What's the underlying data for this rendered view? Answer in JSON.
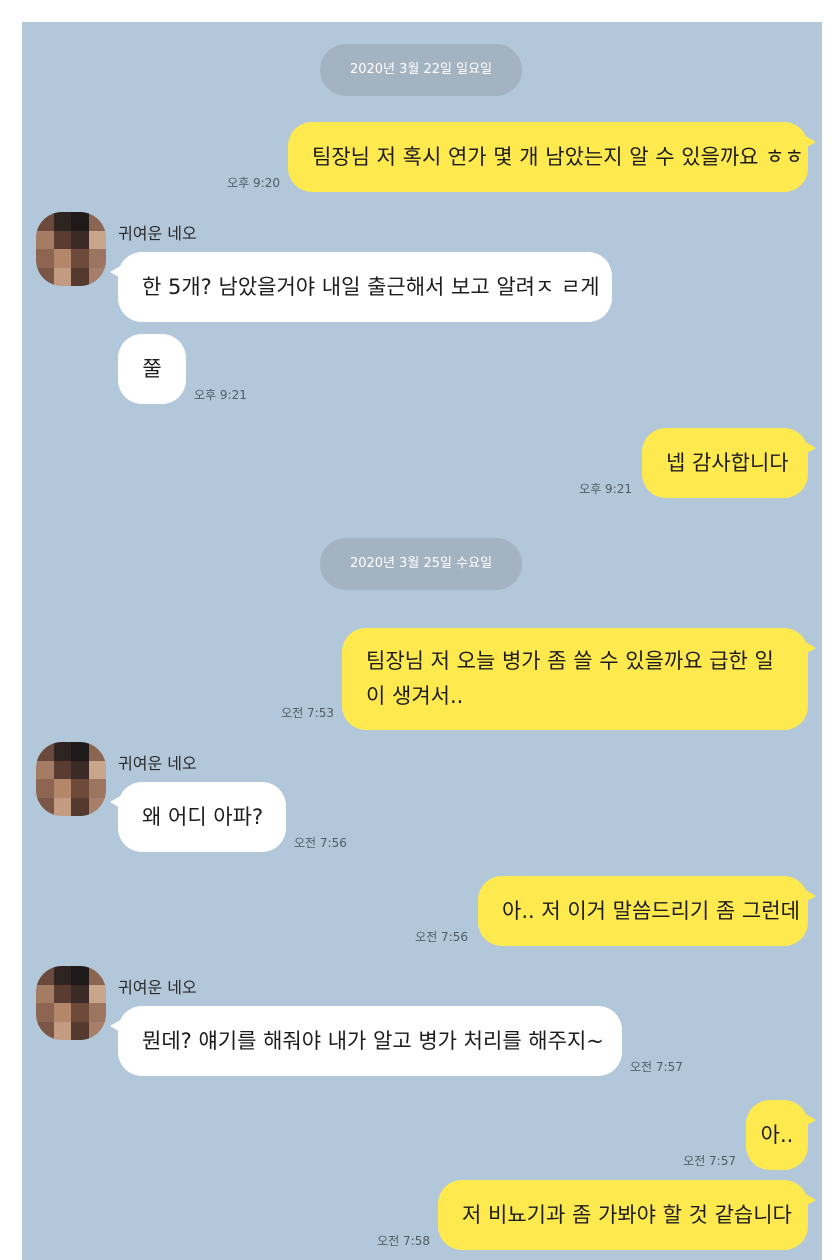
{
  "contact": {
    "name": "귀여운 네오"
  },
  "dates": [
    "2020년 3월 22일 일요일",
    "2020년 3월 25일 수요일"
  ],
  "messages": [
    {
      "text": "팀장님 저 혹시 연가 몇 개 남았는지 알 수 있을까요 ㅎㅎ",
      "time": "오후 9:20"
    },
    {
      "text": "한 5개? 남았을거야 내일 출근해서 보고 알려ㅈ ㄹ게"
    },
    {
      "text": "쭐",
      "time": "오후 9:21"
    },
    {
      "text": "넵 감사합니다",
      "time": "오후 9:21"
    },
    {
      "text": "팀장님 저 오늘 병가 좀 쓸 수 있을까요 급한 일이 생겨서..",
      "time": "오전 7:53"
    },
    {
      "text": "왜 어디 아파?",
      "time": "오전 7:56"
    },
    {
      "text": "아.. 저 이거 말씀드리기 좀 그런데",
      "time": "오전 7:56"
    },
    {
      "text": "뭔데? 얘기를 해줘야 내가 알고 병가 처리를 해주지~",
      "time": "오전 7:57"
    },
    {
      "text": "아..",
      "time": "오전 7:57"
    },
    {
      "text": "저 비뇨기과 좀 가봐야 할 것 같습니다",
      "time": "오전 7:58"
    }
  ],
  "colors": {
    "background": "#b2c7d9",
    "my_bubble": "#fee94e",
    "their_bubble": "#ffffff",
    "date_pill": "#a3b3c2"
  },
  "icons": [
    "pixelated-avatar"
  ]
}
